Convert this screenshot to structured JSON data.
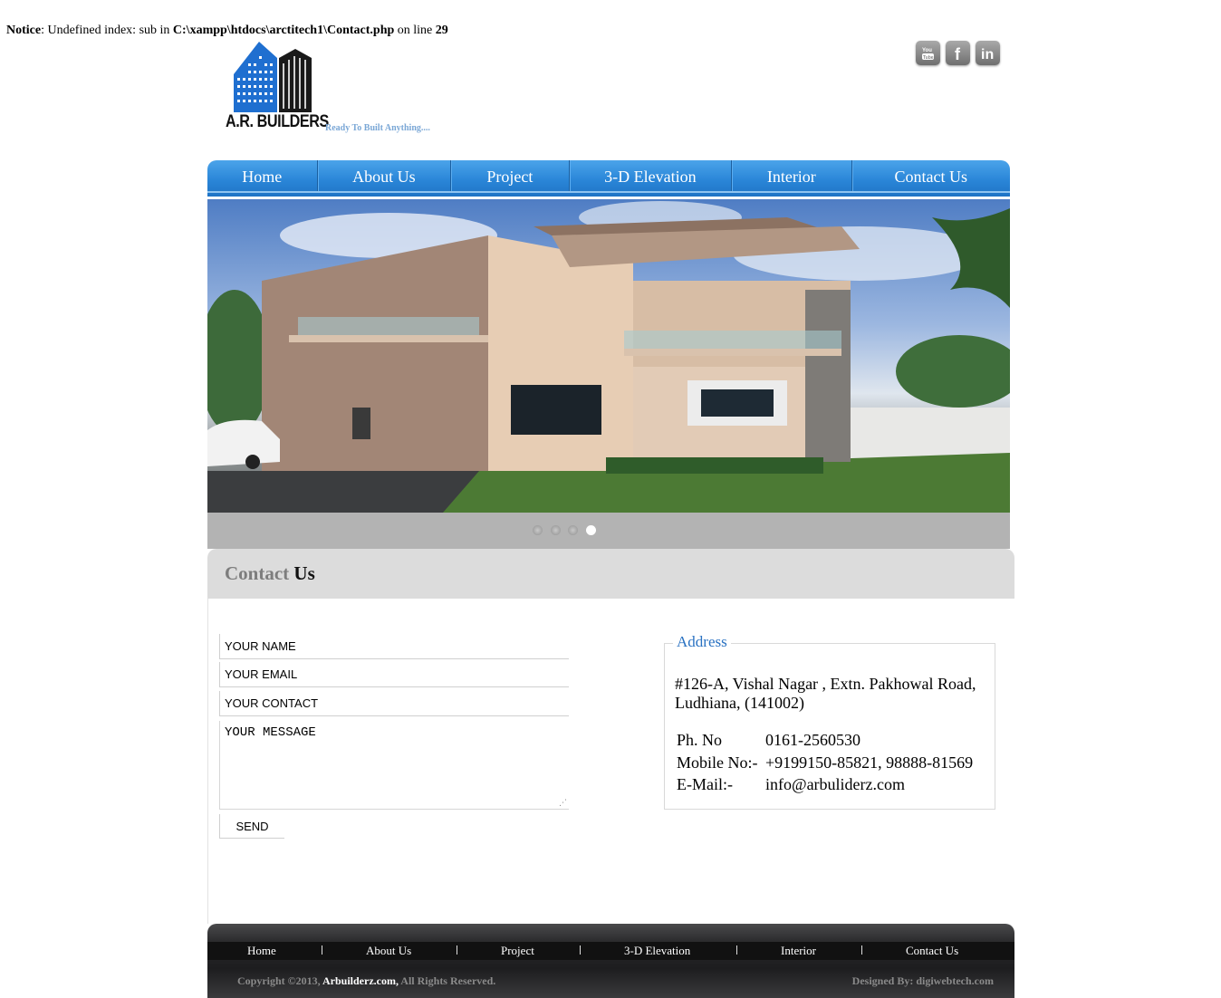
{
  "notice": {
    "label": "Notice",
    "message": ": Undefined index: sub in ",
    "path": "C:\\xampp\\htdocs\\arctitech1\\Contact.php",
    "on_line": " on line ",
    "line": "29"
  },
  "brand": {
    "name": "A.R. BUILDERS",
    "tagline": "Ready To Built Anything...."
  },
  "social": [
    "youtube-icon",
    "facebook-icon",
    "linkedin-icon"
  ],
  "nav": {
    "items": [
      "Home",
      "About Us",
      "Project",
      "3-D Elevation",
      "Interior",
      "Contact Us"
    ]
  },
  "slider": {
    "dots": 4,
    "active_index": 3
  },
  "contact": {
    "title_part1": "Contact",
    "title_part2": "Us",
    "form": {
      "name_placeholder": "YOUR NAME",
      "email_placeholder": "YOUR EMAIL",
      "contact_placeholder": "YOUR CONTACT",
      "message_placeholder": "YOUR MESSAGE",
      "send_label": "SEND"
    },
    "address": {
      "legend": "Address",
      "line1": "#126-A, Vishal Nagar , Extn. Pakhowal Road,",
      "line2": "Ludhiana, (141002)",
      "phone_label": "Ph. No",
      "phone_value": "0161-2560530",
      "mobile_label": "Mobile No:-",
      "mobile_value": "+9199150-85821, 98888-81569",
      "email_label": "E-Mail:-",
      "email_value": "info@arbuliderz.com"
    }
  },
  "footer": {
    "nav": [
      "Home",
      "About Us",
      "Project",
      "3-D Elevation",
      "Interior",
      "Contact Us"
    ],
    "copyright_prefix": "Copyright ©2013, ",
    "copyright_brand": "Arbuilderz.com,",
    "copyright_suffix": " All Rights Reserved.",
    "designed_by": "Designed By: digiwebtech.com"
  },
  "colors": {
    "nav_blue": "#2a86d8",
    "address_legend": "#2a72c2",
    "tagline": "#7aa7d6",
    "footer_dark": "#1d1d1f"
  }
}
